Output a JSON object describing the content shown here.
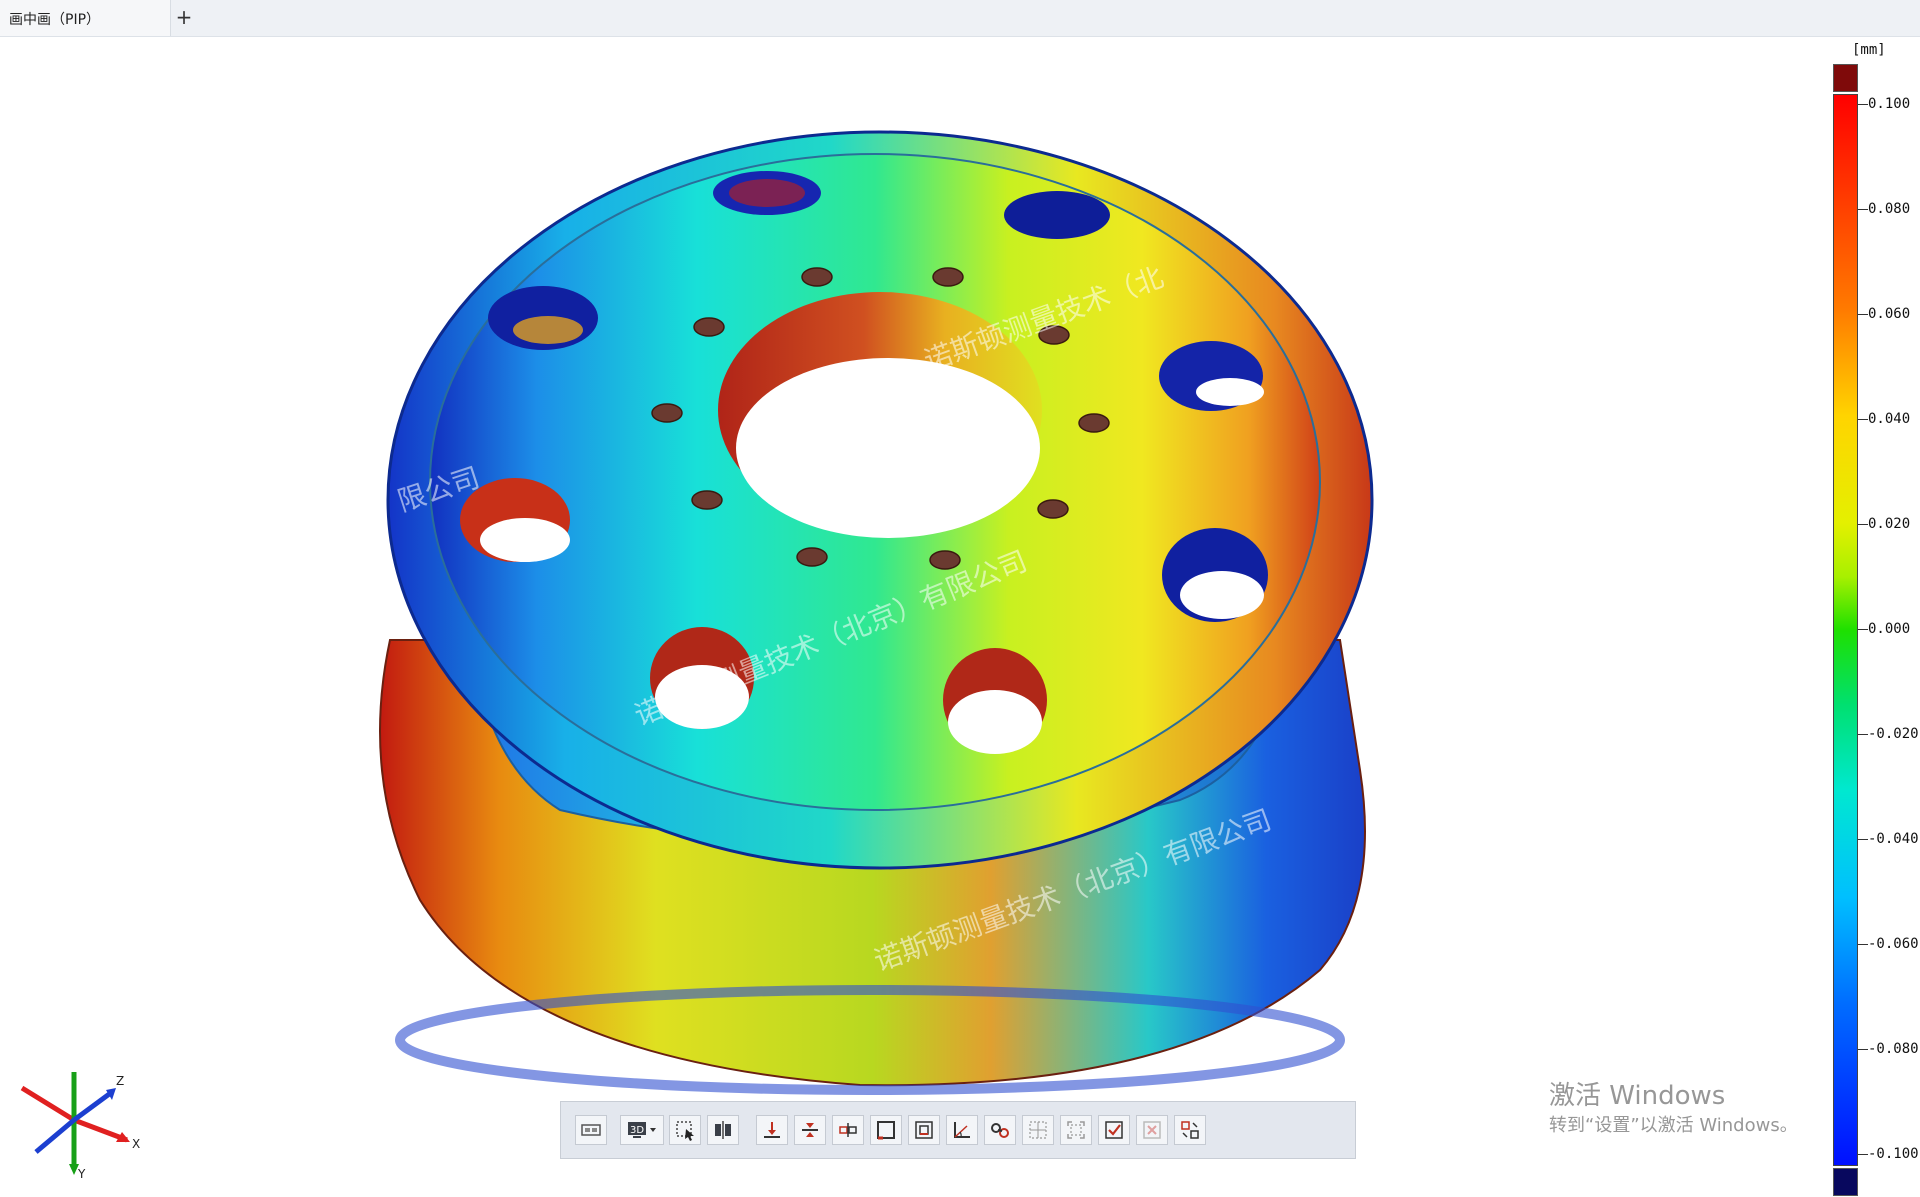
{
  "tabs": {
    "active_label": "画中画（PIP）",
    "add_label": "+"
  },
  "legend": {
    "unit": "[mm]",
    "labels": [
      "0.100",
      "0.080",
      "0.060",
      "0.040",
      "0.020",
      "0.000",
      "-0.020",
      "-0.040",
      "-0.060",
      "-0.080",
      "-0.100"
    ],
    "over_color": "#7f0a0a",
    "under_color": "#08085e"
  },
  "triad": {
    "x_label": "X",
    "y_label": "Y",
    "z_label": "Z",
    "x_color": "#e02020",
    "y_color": "#18a018",
    "z_color": "#1c3fd0"
  },
  "watermark": {
    "text_1": "诺斯顿测量技术（北京）有限公司",
    "text_2": "诺斯顿测量技术（北京）有限公司",
    "text_3": "诺斯顿测量技术（北",
    "text_4": "限公司"
  },
  "toolbar": {
    "buttons": [
      {
        "name": "view-frame-icon"
      },
      {
        "name": "3d-view-icon",
        "label": "3D"
      },
      {
        "name": "select-region-icon"
      },
      {
        "name": "split-view-icon"
      },
      {
        "name": "align-bottom-icon"
      },
      {
        "name": "align-center-icon"
      },
      {
        "name": "distribute-icon"
      },
      {
        "name": "rectangle-icon"
      },
      {
        "name": "frame-fit-icon"
      },
      {
        "name": "angle-measure-icon"
      },
      {
        "name": "link-icon"
      },
      {
        "name": "grid-select-icon"
      },
      {
        "name": "fit-extents-icon"
      },
      {
        "name": "check-box-icon"
      },
      {
        "name": "remove-box-icon"
      },
      {
        "name": "arrange-icon"
      }
    ]
  },
  "activation": {
    "title": "激活 Windows",
    "subtitle": "转到“设置”以激活 Windows。"
  }
}
